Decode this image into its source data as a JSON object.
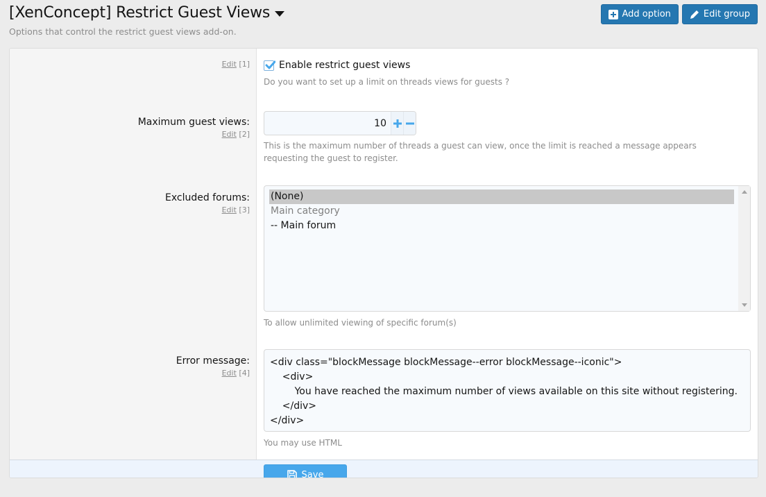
{
  "header": {
    "title": "[XenConcept] Restrict Guest Views",
    "description": "Options that control the restrict guest views add-on.",
    "buttons": {
      "add_option": "Add option",
      "edit_group": "Edit group"
    }
  },
  "options": [
    {
      "label": "",
      "edit_link": "Edit",
      "order": "[1]",
      "checkbox_label": "Enable restrict guest views",
      "checked": true,
      "explain": "Do you want to set up a limit on threads views for guests ?"
    },
    {
      "label": "Maximum guest views:",
      "edit_link": "Edit",
      "order": "[2]",
      "value": "10",
      "explain": "This is the maximum number of threads a guest can view, once the limit is reached a message appears requesting the guest to register."
    },
    {
      "label": "Excluded forums:",
      "edit_link": "Edit",
      "order": "[3]",
      "select_options": [
        {
          "label": "(None)",
          "selected": true,
          "disabled": false
        },
        {
          "label": "Main category",
          "selected": false,
          "disabled": true
        },
        {
          "label": "-- Main forum",
          "selected": false,
          "disabled": false
        }
      ],
      "explain": "To allow unlimited viewing of specific forum(s)"
    },
    {
      "label": "Error message:",
      "edit_link": "Edit",
      "order": "[4]",
      "value": "<div class=\"blockMessage blockMessage--error blockMessage--iconic\">\n    <div>\n        You have reached the maximum number of views available on this site without registering.\n    </div>\n</div>",
      "explain": "You may use HTML"
    }
  ],
  "footer": {
    "save_label": "Save"
  },
  "colors": {
    "primary": "#2577b1",
    "save": "#47a7eb",
    "accent_icon": "#47a7eb"
  }
}
